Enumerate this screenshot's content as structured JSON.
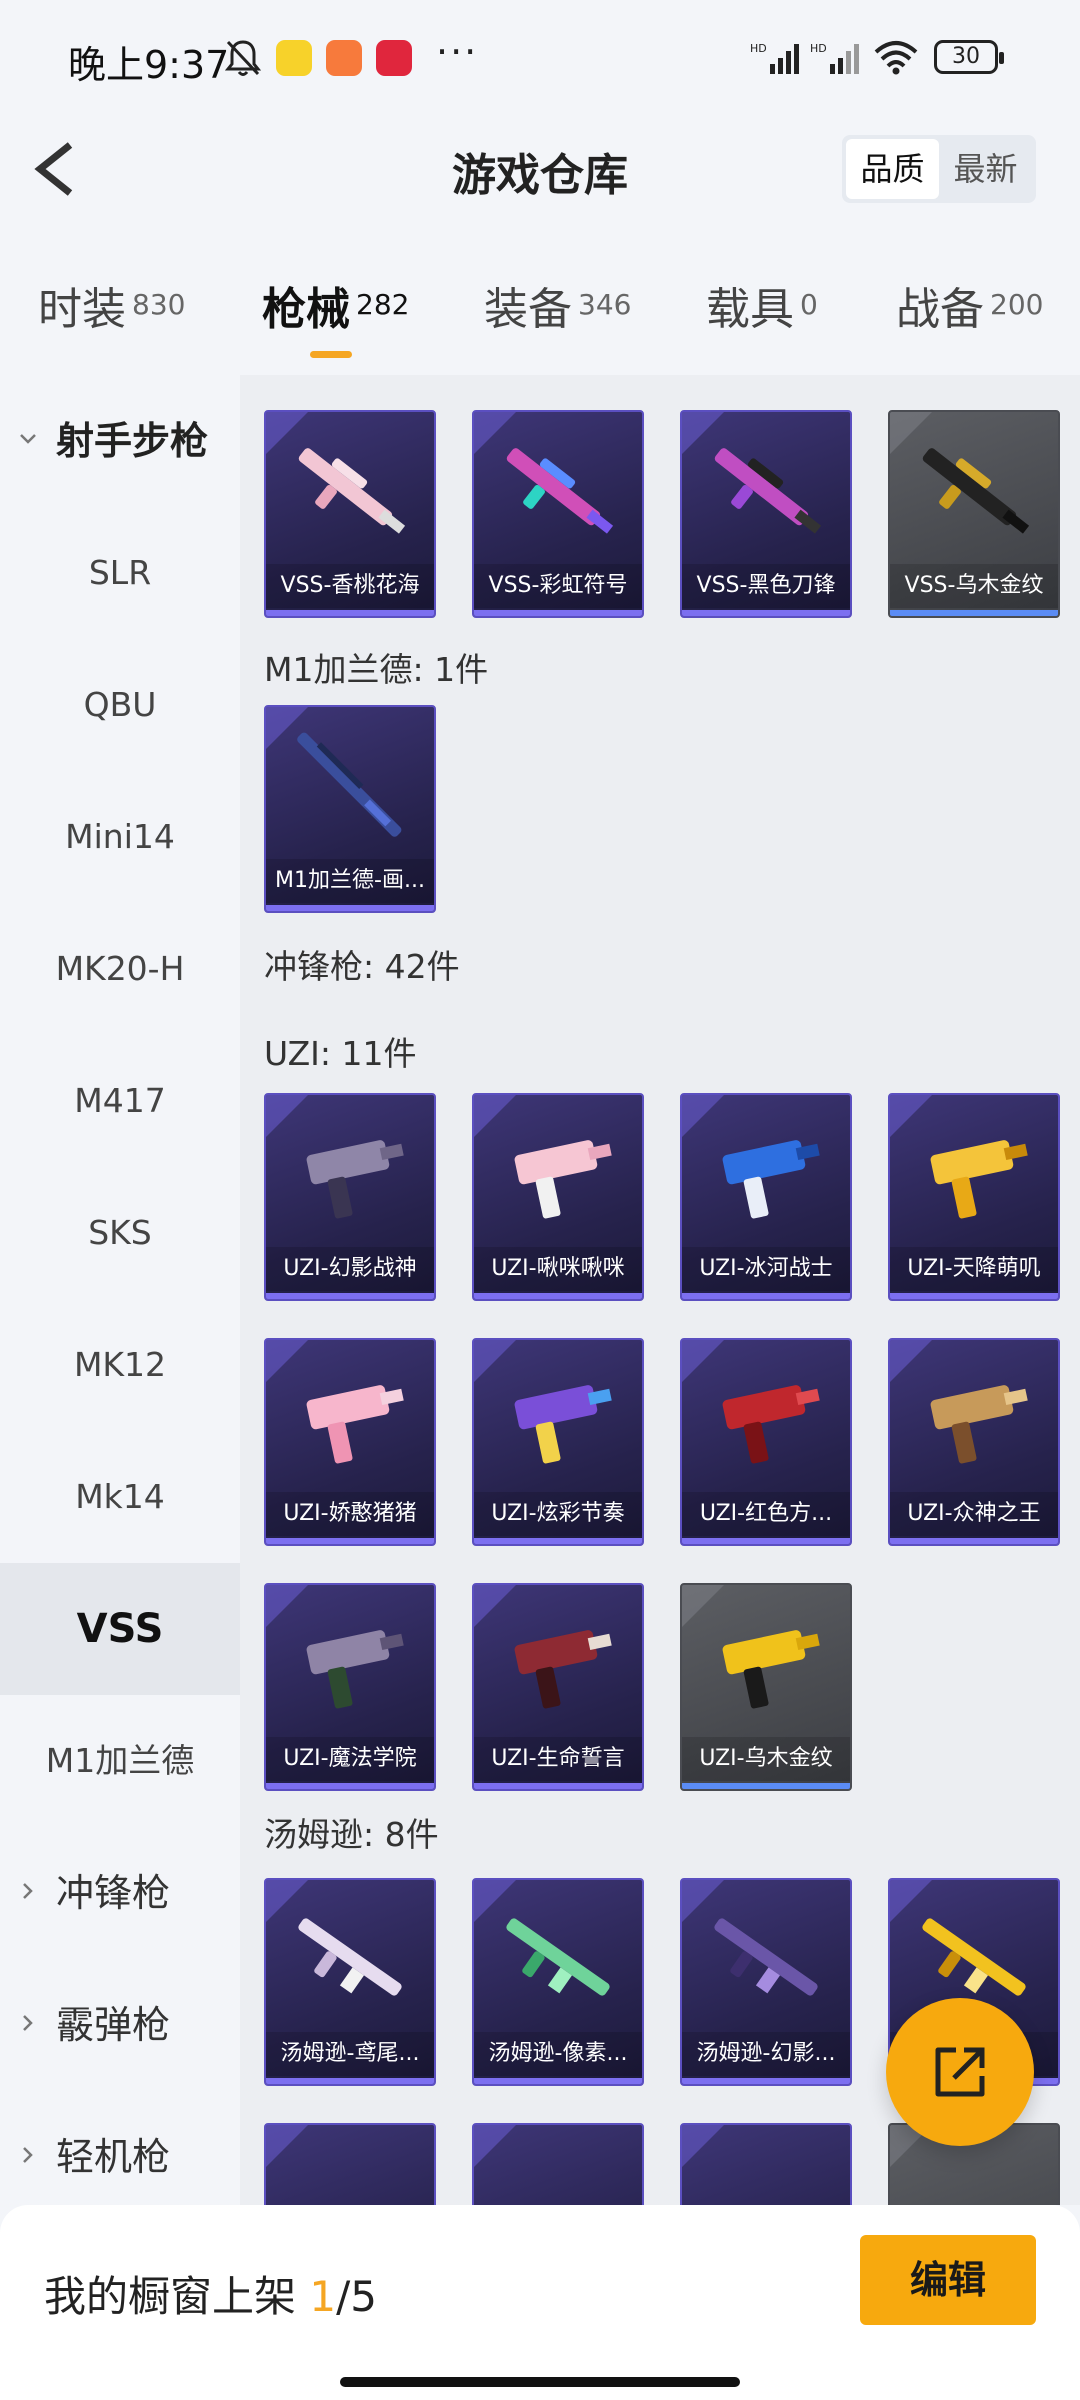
{
  "status_bar": {
    "time": "晚上9:37",
    "more": "···",
    "battery": "30",
    "icons": [
      "bell-off-icon",
      "app-icon",
      "app-icon",
      "app-icon",
      "signal-hd-icon",
      "signal-hd-icon",
      "wifi-icon",
      "battery-icon"
    ]
  },
  "header": {
    "title": "游戏仓库",
    "sort": [
      "品质",
      "最新"
    ],
    "back_icon": "chevron-left-icon"
  },
  "tabs": [
    {
      "label": "时装",
      "count": "830"
    },
    {
      "label": "枪械",
      "count": "282",
      "active": true
    },
    {
      "label": "装备",
      "count": "346"
    },
    {
      "label": "载具",
      "count": "0"
    },
    {
      "label": "战备",
      "count": "200"
    }
  ],
  "sidebar": {
    "group_open": "射手步枪",
    "items": [
      "SLR",
      "QBU",
      "Mini14",
      "MK20-H",
      "M417",
      "SKS",
      "MK12",
      "Mk14",
      "VSS",
      "M1加兰德"
    ],
    "selected": "VSS",
    "collapsed_groups": [
      "冲锋枪",
      "霰弹枪",
      "轻机枪"
    ]
  },
  "content": {
    "vss_items": [
      "VSS-香桃花海",
      "VSS-彩虹符号",
      "VSS-黑色刀锋",
      "VSS-乌木金纹"
    ],
    "m1_header": "M1加兰德: 1件",
    "m1_items": [
      "M1加兰德-画..."
    ],
    "smg_header": "冲锋枪: 42件",
    "uzi_header": "UZI: 11件",
    "uzi_items": [
      "UZI-幻影战神",
      "UZI-啾咪啾咪",
      "UZI-冰河战士",
      "UZI-天降萌叽",
      "UZI-娇憨猪猪",
      "UZI-炫彩节奏",
      "UZI-红色方...",
      "UZI-众神之王",
      "UZI-魔法学院",
      "UZI-生命誓言",
      "UZI-乌木金纹"
    ],
    "tommy_header": "汤姆逊: 8件",
    "tommy_items": [
      "汤姆逊-鸢尾...",
      "汤姆逊-像素...",
      "汤姆逊-幻影...",
      ""
    ]
  },
  "fab": {
    "icon": "share-icon"
  },
  "bottom_bar": {
    "label": "我的橱窗上架",
    "current": "1",
    "total": "/5",
    "edit": "编辑"
  },
  "colors": {
    "accent": "#f7a90e",
    "card_purple": "#2d2858",
    "card_grey": "#4c4e53",
    "tab_underline": "#f5a623"
  }
}
